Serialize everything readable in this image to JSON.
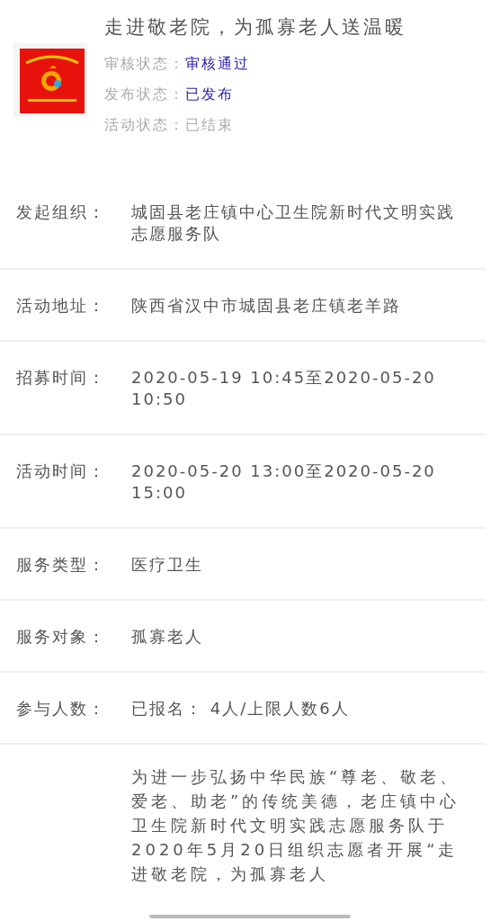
{
  "header": {
    "title": "走进敬老院，为孤寡老人送温暖",
    "statuses": [
      {
        "label": "审核状态：",
        "value": "审核通过",
        "highlight": true
      },
      {
        "label": "发布状态：",
        "value": "已发布",
        "highlight": true
      },
      {
        "label": "活动状态：",
        "value": "已结束",
        "highlight": false
      }
    ]
  },
  "details": [
    {
      "label": "发起组织：",
      "value": "城固县老庄镇中心卫生院新时代文明实践志愿服务队"
    },
    {
      "label": "活动地址：",
      "value": "陕西省汉中市城固县老庄镇老羊路"
    },
    {
      "label": "招募时间：",
      "value": "2020-05-19 10:45至2020-05-20 10:50"
    },
    {
      "label": "活动时间：",
      "value": "2020-05-20 13:00至2020-05-20 15:00"
    },
    {
      "label": "服务类型：",
      "value": "医疗卫生"
    },
    {
      "label": "服务对象：",
      "value": "孤寡老人"
    },
    {
      "label": "参与人数：",
      "value": "已报名： 4人/上限人数6人"
    }
  ],
  "description": "为进一步弘扬中华民族“尊老、敬老、爱老、助老”的传统美德，老庄镇中心卫生院新时代文明实践志愿服务队于2020年5月20日组织志愿者开展“走进敬老院，为孤寡老人"
}
